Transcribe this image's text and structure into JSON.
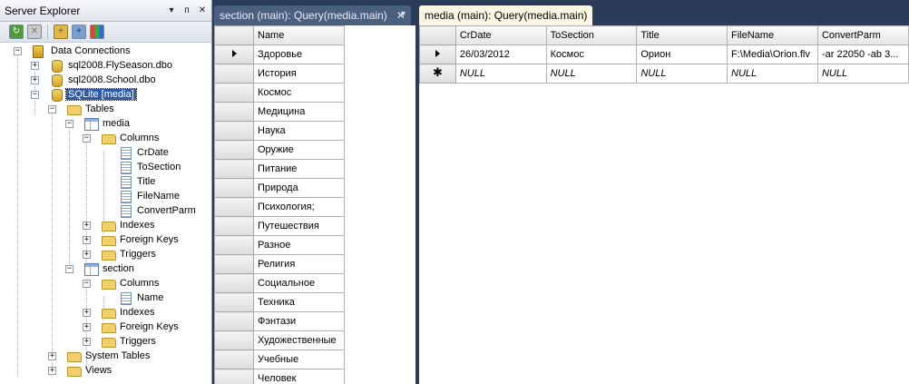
{
  "server_explorer": {
    "title": "Server Explorer",
    "pin_icon": "pin-icon",
    "close_icon": "close-icon",
    "toolbar": [
      "refresh-icon",
      "stop-icon",
      "connect-to-database-icon",
      "connect-to-server-icon",
      "connect-to-sharepoint-icon"
    ],
    "tree": {
      "data_connections": "Data Connections",
      "conn1": "sql2008.FlySeason.dbo",
      "conn2": "sql2008.School.dbo",
      "sqlite": "SQLite [media]",
      "tables": "Tables",
      "media": "media",
      "columns": "Columns",
      "media_cols": [
        "CrDate",
        "ToSection",
        "Title",
        "FileName",
        "ConvertParm"
      ],
      "indexes": "Indexes",
      "foreign_keys": "Foreign Keys",
      "triggers": "Triggers",
      "section": "section",
      "section_cols": [
        "Name"
      ],
      "system_tables": "System Tables",
      "views": "Views"
    }
  },
  "tabs": {
    "section_tab": "section (main): Query(media.main)",
    "media_tab": "media (main): Query(media.main)",
    "close_glyph": "✕",
    "dropdown_glyph": "▾"
  },
  "section_grid": {
    "header": "Name",
    "rows": [
      "Здоровье",
      "История",
      "Космос",
      "Медицина",
      "Наука",
      "Оружие",
      "Питание",
      "Природа",
      "Психология;",
      "Путешествия",
      "Разное",
      "Религия",
      "Социальное",
      "Техника",
      "Фэнтази",
      "Художественные",
      "Учебные",
      "Человек"
    ]
  },
  "media_grid": {
    "headers": [
      "CrDate",
      "ToSection",
      "Title",
      "FileName",
      "ConvertParm"
    ],
    "rows": [
      [
        "26/03/2012",
        "Космос",
        "Орион",
        "F:\\Media\\Orion.flv",
        "-ar 22050 -ab 3..."
      ]
    ],
    "new_row": [
      "NULL",
      "NULL",
      "NULL",
      "NULL",
      "NULL"
    ],
    "new_row_glyph": "✱"
  }
}
